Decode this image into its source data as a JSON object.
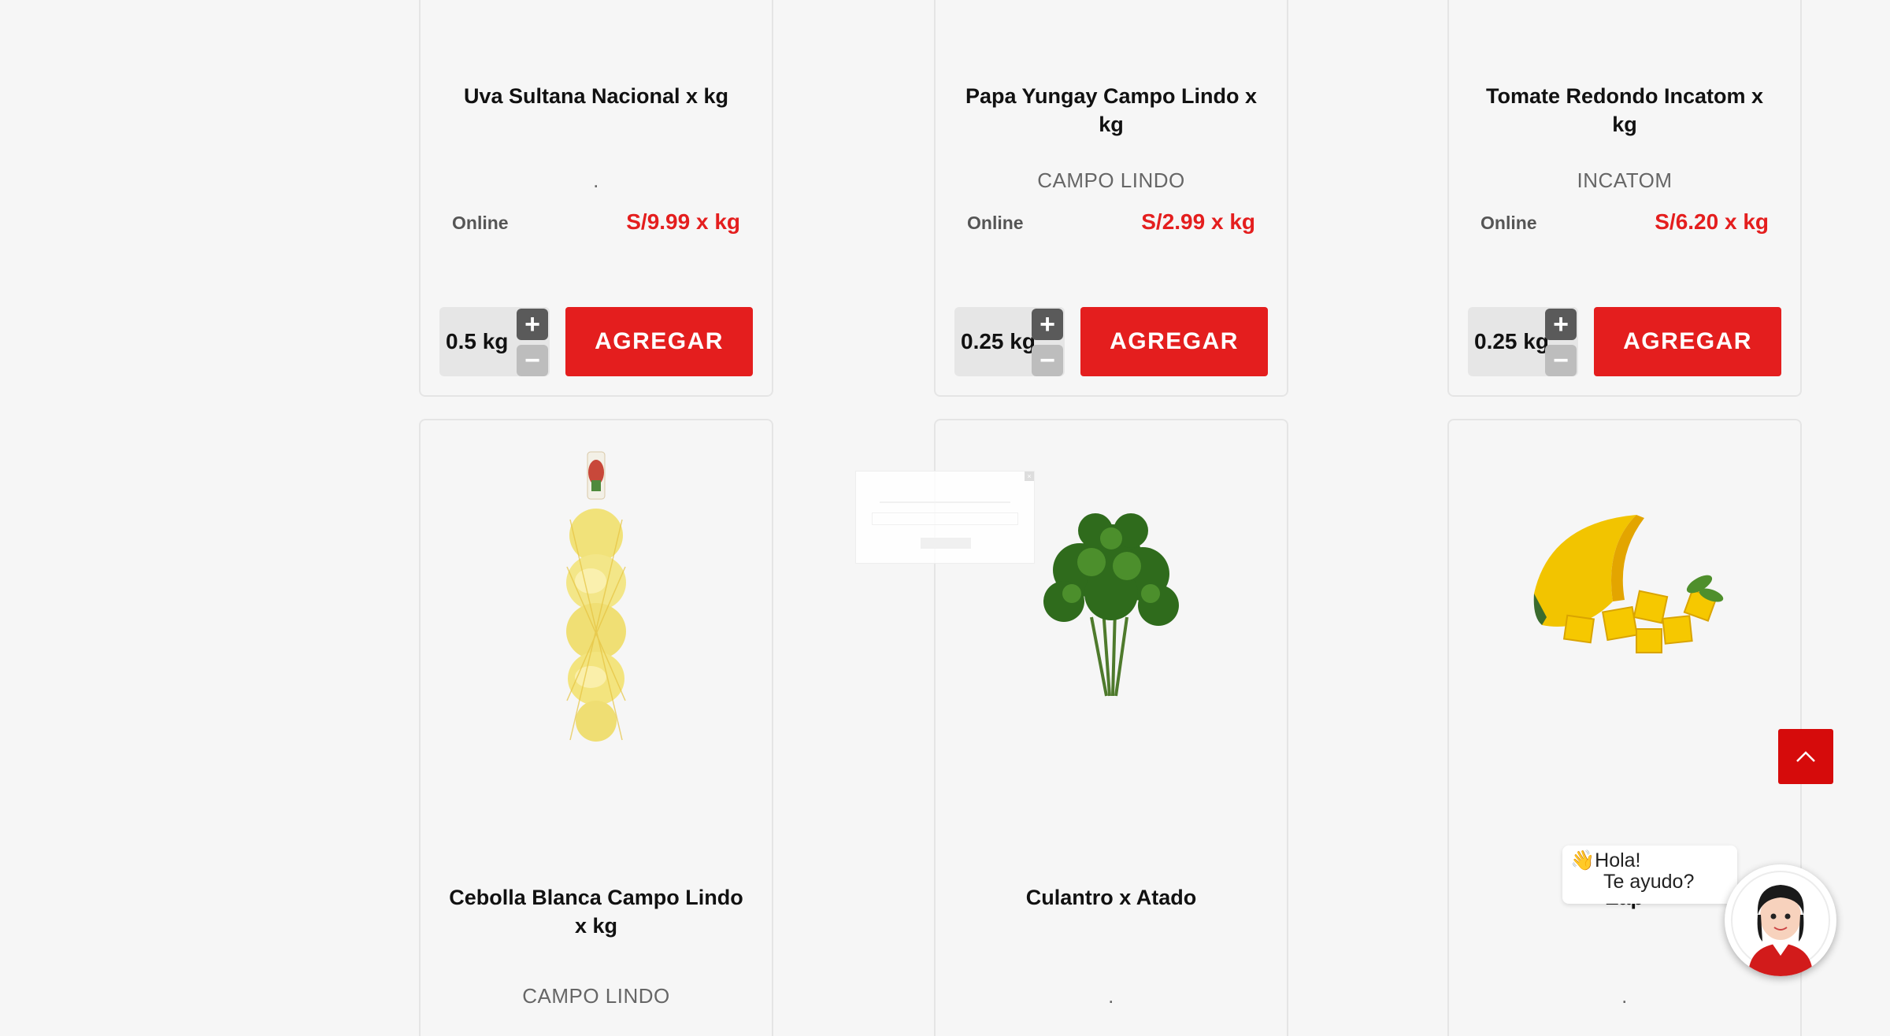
{
  "products": [
    {
      "name": "Uva Sultana Nacional x kg",
      "brand": ".",
      "channel": "Online",
      "price": "S/9.99 x kg",
      "quantity": "0.5 kg",
      "add_label": "AGREGAR"
    },
    {
      "name": "Papa Yungay Campo Lindo x kg",
      "brand": "CAMPO LINDO",
      "channel": "Online",
      "price": "S/2.99 x kg",
      "quantity": "0.25 kg",
      "add_label": "AGREGAR"
    },
    {
      "name": "Tomate Redondo Incatom x kg",
      "brand": "INCATOM",
      "channel": "Online",
      "price": "S/6.20 x kg",
      "quantity": "0.25 kg",
      "add_label": "AGREGAR"
    },
    {
      "name": "Cebolla Blanca Campo Lindo x kg",
      "brand": "CAMPO LINDO",
      "image": "onion-net-bag"
    },
    {
      "name": "Culantro x Atado",
      "brand": ".",
      "image": "cilantro-bunch"
    },
    {
      "name": "Zap",
      "brand": ".",
      "image": "pumpkin-pieces"
    }
  ],
  "qty_controls": {
    "plus": "+",
    "minus": "−"
  },
  "chat": {
    "emoji": "👋",
    "line1": "Hola!",
    "line2": "Te ayudo?"
  },
  "colors": {
    "accent": "#e41e1e",
    "scroll_top": "#d60b0b",
    "background": "#f6f6f6"
  },
  "icons": {
    "scroll_top": "chevron-up-icon",
    "chat": "assistant-avatar-icon"
  }
}
